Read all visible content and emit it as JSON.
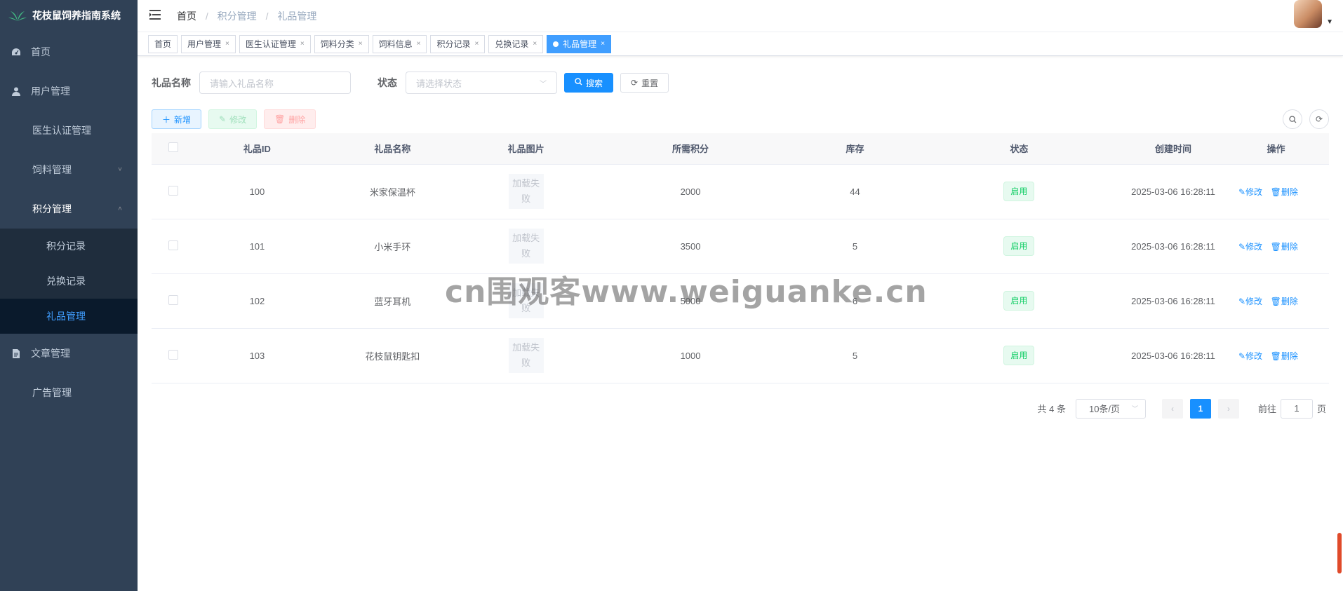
{
  "app": {
    "title": "花枝鼠饲养指南系统"
  },
  "sidebar": {
    "items": [
      {
        "label": "首页",
        "icon": "dashboard-icon"
      },
      {
        "label": "用户管理",
        "icon": "user-icon"
      },
      {
        "label": "医生认证管理"
      },
      {
        "label": "饲料管理",
        "arrow": "˅"
      },
      {
        "label": "积分管理",
        "arrow": "˄"
      },
      {
        "label": "文章管理",
        "icon": "document-icon"
      },
      {
        "label": "广告管理"
      }
    ],
    "sub_points": [
      {
        "label": "积分记录"
      },
      {
        "label": "兑换记录"
      },
      {
        "label": "礼品管理"
      }
    ]
  },
  "breadcrumb": {
    "home": "首页",
    "parent": "积分管理",
    "current": "礼品管理"
  },
  "tags": [
    {
      "label": "首页"
    },
    {
      "label": "用户管理"
    },
    {
      "label": "医生认证管理"
    },
    {
      "label": "饲料分类"
    },
    {
      "label": "饲料信息"
    },
    {
      "label": "积分记录"
    },
    {
      "label": "兑换记录"
    },
    {
      "label": "礼品管理"
    }
  ],
  "search": {
    "name_label": "礼品名称",
    "name_placeholder": "请输入礼品名称",
    "status_label": "状态",
    "status_placeholder": "请选择状态",
    "search_btn": "搜索",
    "reset_btn": "重置"
  },
  "toolbar": {
    "add": "新增",
    "edit": "修改",
    "delete": "删除"
  },
  "table": {
    "headers": [
      "礼品ID",
      "礼品名称",
      "礼品图片",
      "所需积分",
      "库存",
      "状态",
      "创建时间",
      "操作"
    ],
    "img_fail_1": "加载失",
    "img_fail_2": "败",
    "op_edit": "修改",
    "op_delete": "删除",
    "rows": [
      {
        "id": "100",
        "name": "米家保温杯",
        "points": "2000",
        "stock": "44",
        "status": "启用",
        "created": "2025-03-06 16:28:11"
      },
      {
        "id": "101",
        "name": "小米手环",
        "points": "3500",
        "stock": "5",
        "status": "启用",
        "created": "2025-03-06 16:28:11"
      },
      {
        "id": "102",
        "name": "蓝牙耳机",
        "points": "5000",
        "stock": "6",
        "status": "启用",
        "created": "2025-03-06 16:28:11"
      },
      {
        "id": "103",
        "name": "花枝鼠钥匙扣",
        "points": "1000",
        "stock": "5",
        "status": "启用",
        "created": "2025-03-06 16:28:11"
      }
    ]
  },
  "pagination": {
    "total": "共 4 条",
    "page_size": "10条/页",
    "current": "1",
    "goto_label": "前往",
    "goto_value": "1",
    "page_suffix": "页"
  },
  "watermark": "cn围观客www.weiguanke.cn",
  "colors": {
    "sidebar": "#304156",
    "primary": "#1890ff",
    "active_menu": "#409eff",
    "success": "#13ce66"
  }
}
